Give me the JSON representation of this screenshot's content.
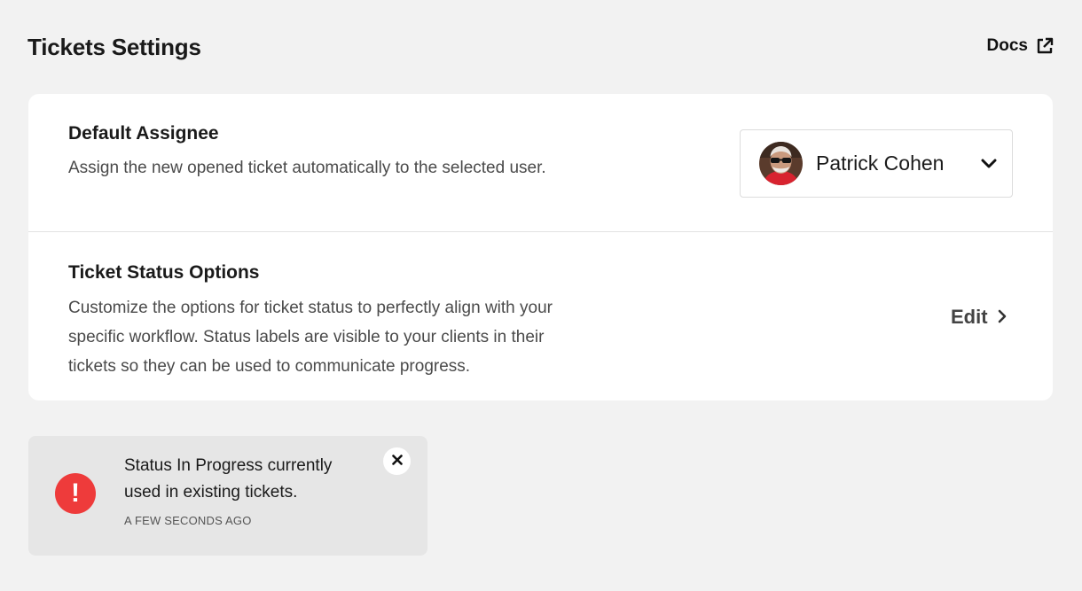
{
  "header": {
    "title": "Tickets Settings",
    "docs_label": "Docs",
    "docs_icon": "external-link-icon"
  },
  "settings": {
    "default_assignee": {
      "title": "Default Assignee",
      "description": "Assign the new opened ticket automatically to the selected user.",
      "selected_user": "Patrick Cohen",
      "dropdown_icon": "chevron-down-icon"
    },
    "status_options": {
      "title": "Ticket Status Options",
      "description": "Customize the options for ticket status to perfectly align with your specific workflow. Status labels are visible to your clients in their tickets so they can be used to communicate progress.",
      "edit_label": "Edit",
      "edit_icon": "chevron-right-icon"
    }
  },
  "toast": {
    "icon_text": "!",
    "icon": "exclamation-icon",
    "message": "Status In Progress currently used in existing tickets.",
    "time": "A FEW SECONDS AGO",
    "close_icon": "close-icon"
  },
  "colors": {
    "background": "#f2f2f2",
    "card": "#ffffff",
    "toast_bg": "#e6e6e6",
    "error": "#ee3b3b"
  }
}
